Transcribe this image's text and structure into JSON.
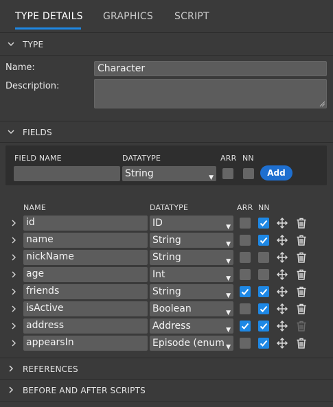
{
  "tabs": [
    "TYPE DETAILS",
    "GRAPHICS",
    "SCRIPT"
  ],
  "sections": {
    "type": "TYPE",
    "fields": "FIELDS",
    "references": "REFERENCES",
    "scripts": "BEFORE AND AFTER SCRIPTS"
  },
  "type_form": {
    "name_label": "Name:",
    "name_value": "Character",
    "description_label": "Description:",
    "description_value": ""
  },
  "new_field": {
    "headers": {
      "field_name": "FIELD NAME",
      "datatype": "DATATYPE",
      "arr": "ARR",
      "nn": "NN"
    },
    "field_name_value": "",
    "datatype_value": "String",
    "arr": false,
    "nn": false,
    "add_label": "Add"
  },
  "fields_table": {
    "headers": {
      "name": "NAME",
      "datatype": "DATATYPE",
      "arr": "ARR",
      "nn": "NN"
    },
    "rows": [
      {
        "name": "id",
        "datatype": "ID",
        "arr": false,
        "nn": true,
        "delete_enabled": true
      },
      {
        "name": "name",
        "datatype": "String",
        "arr": false,
        "nn": true,
        "delete_enabled": true
      },
      {
        "name": "nickName",
        "datatype": "String",
        "arr": false,
        "nn": false,
        "delete_enabled": true
      },
      {
        "name": "age",
        "datatype": "Int",
        "arr": false,
        "nn": false,
        "delete_enabled": true
      },
      {
        "name": "friends",
        "datatype": "String",
        "arr": true,
        "nn": true,
        "delete_enabled": true
      },
      {
        "name": "isActive",
        "datatype": "Boolean",
        "arr": false,
        "nn": true,
        "delete_enabled": true
      },
      {
        "name": "address",
        "datatype": "Address",
        "arr": true,
        "nn": true,
        "delete_enabled": false
      },
      {
        "name": "appearsIn",
        "datatype": "Episode (enum)",
        "arr": false,
        "nn": true,
        "delete_enabled": true
      }
    ]
  },
  "icons": {
    "expand": "chevron-right-icon",
    "collapse": "chevron-down-icon",
    "move": "move-icon",
    "delete": "trash-icon"
  },
  "colors": {
    "background": "#3a3a3a",
    "input": "#5c5c5c",
    "accent": "#1e88e5",
    "add_button": "#1e6fd0"
  }
}
